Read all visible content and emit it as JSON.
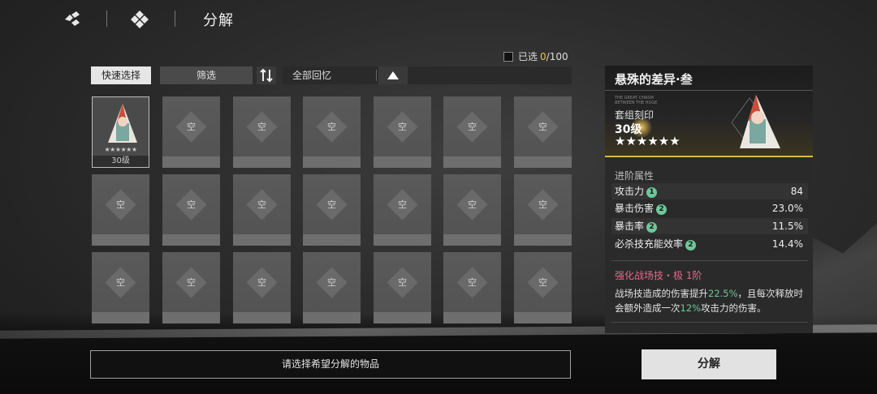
{
  "header": {
    "back_icon": "diamond-cluster-back-icon",
    "home_icon": "four-diamond-home-icon",
    "title": "分解"
  },
  "selection": {
    "label": "已选",
    "current": "0",
    "total": "/100"
  },
  "toolbar": {
    "quick_select": "快速选择",
    "filter": "筛选",
    "sort_icon": "sort-order-icon",
    "dropdown_value": "全部回忆"
  },
  "grid": {
    "empty_label": "空",
    "filled_item": {
      "stars": "★★★★★★",
      "level": "30级"
    }
  },
  "detail": {
    "name": "悬殊的差异·叁",
    "tiny_text": "THE GREAT CHASM BETWEEN THE HUGE",
    "set_label": "套组刻印",
    "level": "30级",
    "stars": "★★★★★★",
    "attr_title": "进阶属性",
    "attrs": [
      {
        "name": "攻击力",
        "badge": "1",
        "value": "84"
      },
      {
        "name": "暴击伤害",
        "badge": "2",
        "value": "23.0%"
      },
      {
        "name": "暴击率",
        "badge": "2",
        "value": "11.5%"
      },
      {
        "name": "必杀技充能效率",
        "badge": "2",
        "value": "14.4%"
      }
    ],
    "skill_title": "强化战场技・极 1阶",
    "skill_desc_1": "战场技造成的伤害提升",
    "skill_hl_1": "22.5%",
    "skill_desc_2": "，且每次释放时会额外造成一次",
    "skill_hl_2": "12%",
    "skill_desc_3": "攻击力的伤害。"
  },
  "bottom": {
    "hint": "请选择希望分解的物品",
    "decompose": "分解"
  },
  "colors": {
    "accent_gold": "#d9b84a",
    "selection_count": "#e8c35a",
    "badge_green": "#6fc79a",
    "skill_pink": "#e56a8e"
  }
}
